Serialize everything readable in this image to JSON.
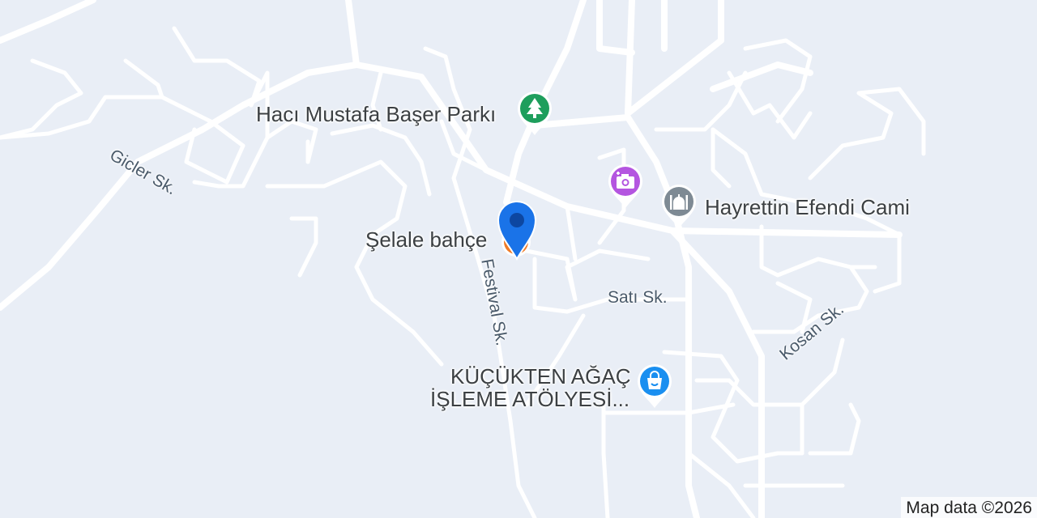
{
  "map": {
    "pois": [
      {
        "id": "park",
        "label": "Hacı Mustafa Başer Parkı",
        "icon": "tree-icon",
        "color": "#1e9e5c"
      },
      {
        "id": "photo",
        "label": "",
        "icon": "camera-icon",
        "color": "#b455e0"
      },
      {
        "id": "mosque",
        "label": "Hayrettin Efendi Cami",
        "icon": "mosque-icon",
        "color": "#7e8a94"
      },
      {
        "id": "restaurant",
        "label": "Şelale bahçe",
        "icon": "fork-knife-icon",
        "color": "#f07b27"
      },
      {
        "id": "shop",
        "label_line1": "KÜÇÜKTEN AĞAÇ",
        "label_line2": "İŞLEME ATÖLYESİ...",
        "icon": "shopping-bag-icon",
        "color": "#1a8ff0"
      }
    ],
    "streets": {
      "gicler": "Gicler Sk.",
      "festival": "Festival Sk.",
      "sati": "Satı Sk.",
      "kosan": "Kosan Sk."
    },
    "selected_marker": {
      "icon": "location-pin-icon",
      "color": "#1a73e8"
    },
    "attribution": "Map data ©2026"
  }
}
